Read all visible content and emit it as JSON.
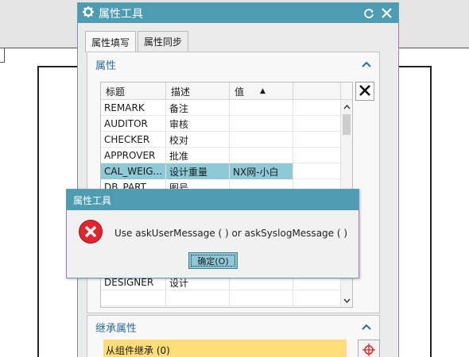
{
  "colors": {
    "titlebar": "#4e9cb1",
    "selected_row": "#8ec9d8",
    "section_text": "#2a6f9a",
    "inherit_bg": "#fddd7a",
    "error_red": "#e0262c"
  },
  "dialog": {
    "title": "属性工具",
    "icons": [
      "gear-icon",
      "reset-icon",
      "close-icon"
    ],
    "tabs": [
      {
        "label": "属性填写",
        "active": true
      },
      {
        "label": "属性同步",
        "active": false
      }
    ],
    "attributes_section": {
      "title": "属性",
      "columns": [
        "标题",
        "描述",
        "值"
      ],
      "sort_indicator": "▲",
      "rows": [
        {
          "title": "REMARK",
          "desc": "备注",
          "value": ""
        },
        {
          "title": "AUDITOR",
          "desc": "审核",
          "value": ""
        },
        {
          "title": "CHECKER",
          "desc": "校对",
          "value": ""
        },
        {
          "title": "APPROVER",
          "desc": "批准",
          "value": ""
        },
        {
          "title": "CAL_WEIG...",
          "desc": "设计重量",
          "value": "NX网-小白",
          "selected": true
        },
        {
          "title": "DB_PART_...",
          "desc": "图号",
          "value": ""
        },
        {
          "title": "",
          "desc": "",
          "value": ""
        },
        {
          "title": "",
          "desc": "",
          "value": ""
        },
        {
          "title": "",
          "desc": "",
          "value": ""
        },
        {
          "title": "",
          "desc": "",
          "value": ""
        },
        {
          "title": "",
          "desc": "",
          "value": ""
        },
        {
          "title": "DESIGNER",
          "desc": "设计",
          "value": ""
        },
        {
          "title": "",
          "desc": "",
          "value": ""
        }
      ],
      "delete_icon": "delete-x-icon"
    },
    "inherit_section": {
      "title": "继承属性",
      "item": "从组件继承 (0)",
      "select_icon": "crosshair-target-icon"
    }
  },
  "message_box": {
    "title": "属性工具",
    "icon": "error-icon",
    "text": "Use askUserMessage ( ) or askSyslogMessage ( )",
    "ok_label": "确定(O)"
  }
}
